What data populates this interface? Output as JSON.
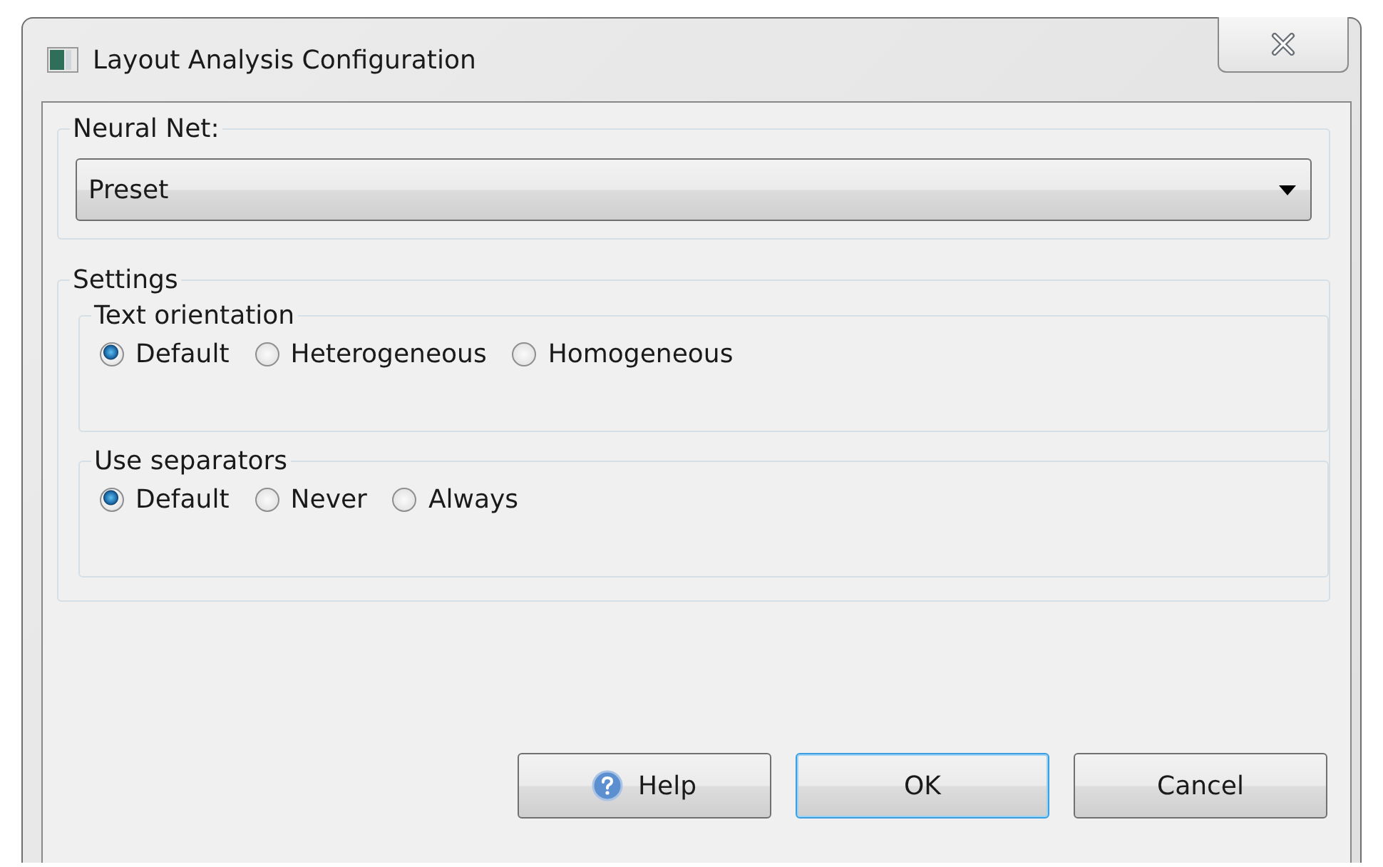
{
  "window": {
    "title": "Layout Analysis Configuration"
  },
  "neural_net": {
    "label": "Neural Net:",
    "dropdown": {
      "value": "Preset"
    }
  },
  "settings": {
    "label": "Settings",
    "groups": [
      {
        "label": "Text orientation",
        "options": [
          {
            "label": "Default",
            "selected": true
          },
          {
            "label": "Heterogeneous",
            "selected": false
          },
          {
            "label": "Homogeneous",
            "selected": false
          }
        ]
      },
      {
        "label": "Use separators",
        "options": [
          {
            "label": "Default",
            "selected": true
          },
          {
            "label": "Never",
            "selected": false
          },
          {
            "label": "Always",
            "selected": false
          }
        ]
      }
    ]
  },
  "buttons": [
    {
      "label": "Help",
      "kind": "help"
    },
    {
      "label": "OK",
      "kind": "default"
    },
    {
      "label": "Cancel",
      "kind": "plain"
    }
  ]
}
